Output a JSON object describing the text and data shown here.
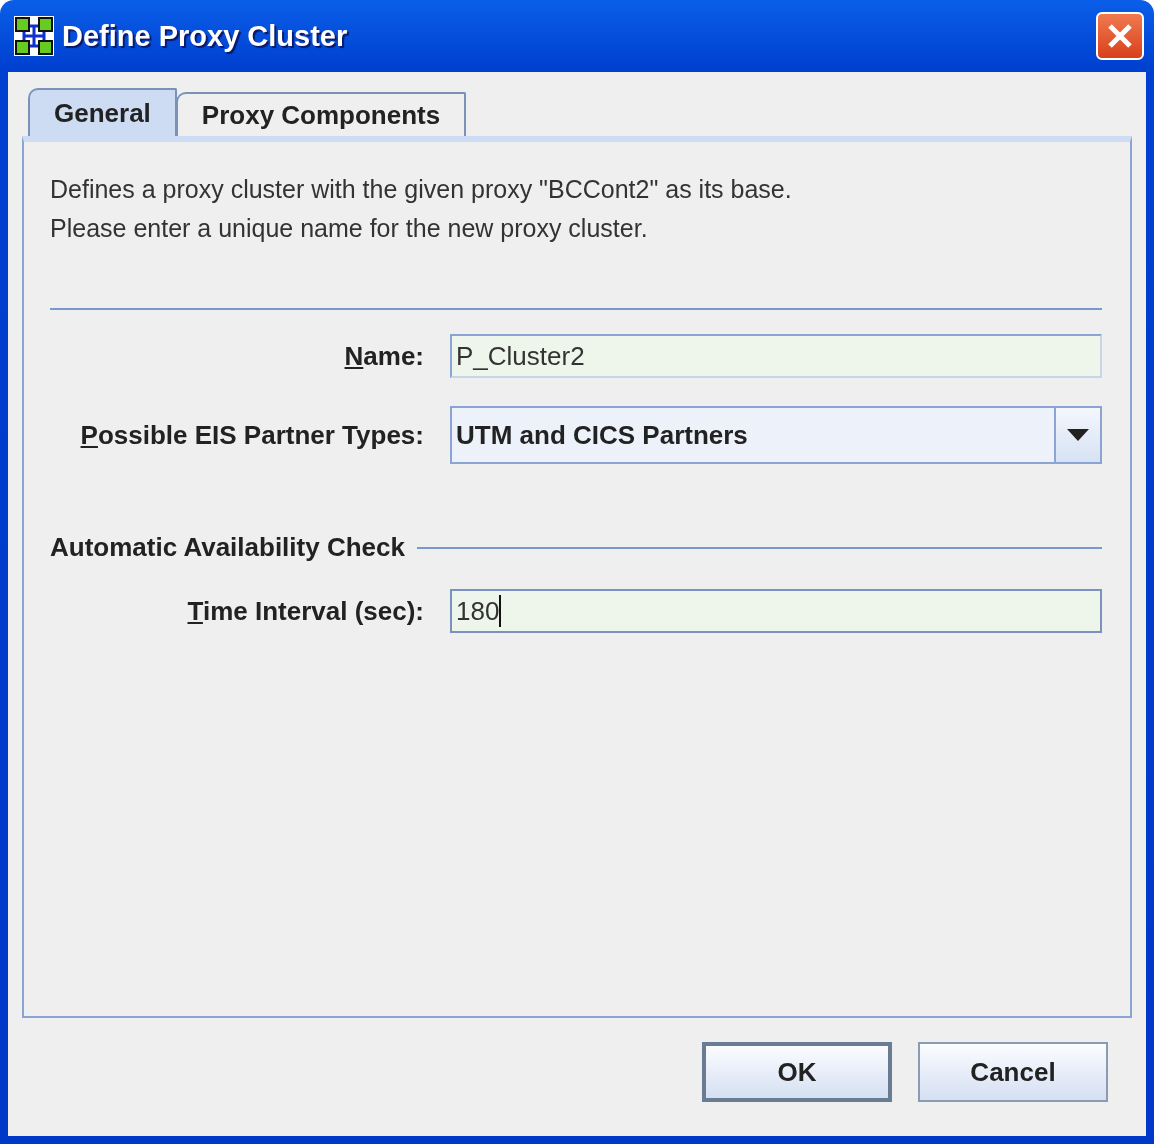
{
  "window": {
    "title": "Define Proxy Cluster"
  },
  "tabs": [
    {
      "label": "General",
      "selected": true
    },
    {
      "label": "Proxy Components",
      "selected": false
    }
  ],
  "description": [
    "Defines a proxy cluster with the given proxy \"BCCont2\" as its base.",
    "Please enter a unique name for the new proxy cluster."
  ],
  "fields": [
    {
      "kind": "text",
      "label": "Name:",
      "underline_first": true,
      "value": "P_Cluster2",
      "focused": false
    },
    {
      "kind": "combo",
      "label": "Possible EIS Partner Types:",
      "underline_first": true,
      "value": "UTM and CICS Partners",
      "focused": false
    }
  ],
  "section": {
    "title": "Automatic Availability Check",
    "fields": [
      {
        "kind": "text",
        "label": "Time Interval (sec):",
        "underline_first": true,
        "value": "180",
        "focused": true
      }
    ]
  },
  "buttons": [
    {
      "label": "OK",
      "default": true
    },
    {
      "label": "Cancel",
      "default": false
    }
  ]
}
